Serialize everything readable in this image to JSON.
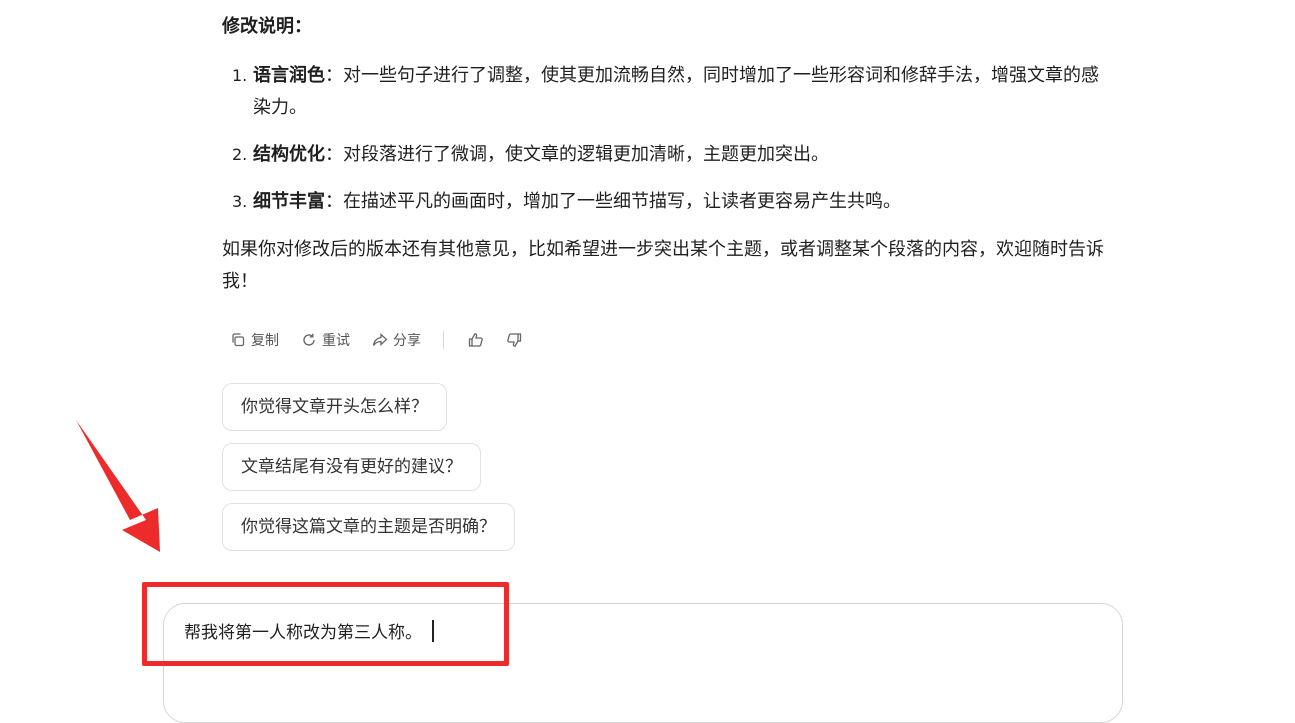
{
  "heading": "修改说明：",
  "changes": [
    {
      "number": "1.",
      "title": "语言润色",
      "text": "：对一些句子进行了调整，使其更加流畅自然，同时增加了一些形容词和修辞手法，增强文章的感染力。"
    },
    {
      "number": "2.",
      "title": "结构优化",
      "text": "：对段落进行了微调，使文章的逻辑更加清晰，主题更加突出。"
    },
    {
      "number": "3.",
      "title": "细节丰富",
      "text": "：在描述平凡的画面时，增加了一些细节描写，让读者更容易产生共鸣。"
    }
  ],
  "closing": "如果你对修改后的版本还有其他意见，比如希望进一步突出某个主题，或者调整某个段落的内容，欢迎随时告诉我！",
  "actions": {
    "copy": "复制",
    "retry": "重试",
    "share": "分享",
    "like_icon": "thumbs-up-icon",
    "dislike_icon": "thumbs-down-icon"
  },
  "suggestions": [
    "你觉得文章开头怎么样？",
    "文章结尾有没有更好的建议？",
    "你觉得这篇文章的主题是否明确？"
  ],
  "composer": {
    "value": "帮我将第一人称改为第三人称。"
  },
  "colors": {
    "annotation": "#ee2b2b",
    "text": "#1f1f1f",
    "muted": "#555555",
    "border": "#e1e1e1"
  }
}
